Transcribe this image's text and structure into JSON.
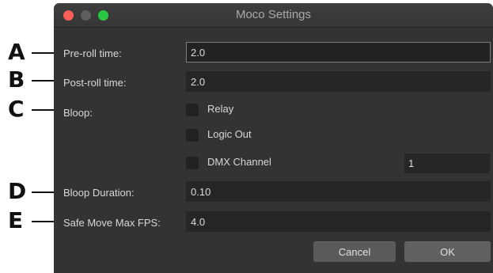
{
  "window": {
    "title": "Moco Settings"
  },
  "callouts": [
    "A",
    "B",
    "C",
    "D",
    "E"
  ],
  "fields": {
    "preroll": {
      "label": "Pre-roll time:",
      "value": "2.0"
    },
    "postroll": {
      "label": "Post-roll time:",
      "value": "2.0"
    },
    "bloop": {
      "label": "Bloop:"
    },
    "bloop_duration": {
      "label": "Bloop Duration:",
      "value": "0.10"
    },
    "safe_move": {
      "label": "Safe Move Max FPS:",
      "value": "4.0"
    }
  },
  "bloop_options": {
    "relay": {
      "label": "Relay",
      "checked": false
    },
    "logic_out": {
      "label": "Logic Out",
      "checked": false
    },
    "dmx": {
      "label": "DMX Channel",
      "checked": false,
      "channel": "1"
    }
  },
  "buttons": {
    "cancel": "Cancel",
    "ok": "OK"
  },
  "colors": {
    "window_bg": "#333333",
    "field_bg": "#262626",
    "close": "#fc5f57",
    "minimize": "#5e5e5e",
    "zoom": "#29c740"
  }
}
